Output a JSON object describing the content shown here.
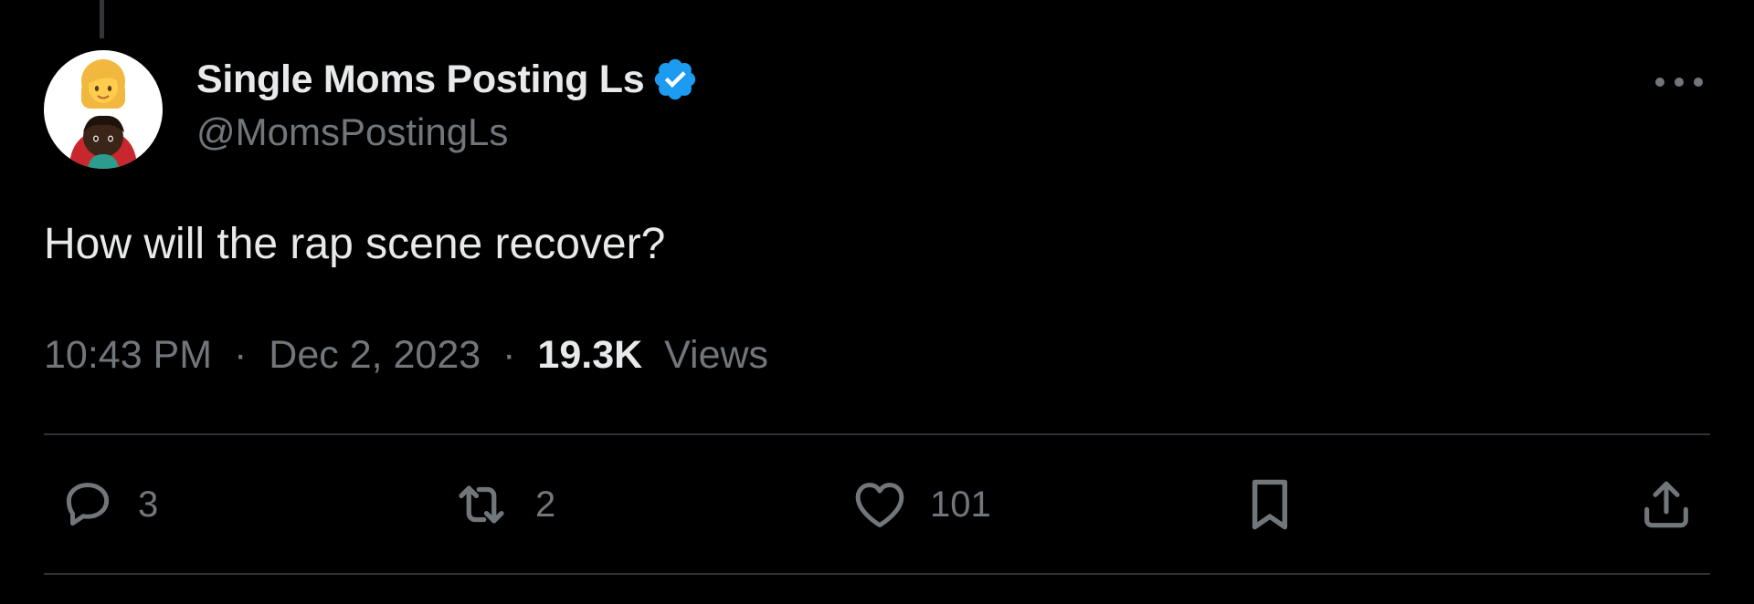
{
  "author": {
    "display_name": "Single Moms Posting Ls",
    "handle": "@MomsPostingLs",
    "verified": true,
    "avatar_icon": "woman-and-child-emoji-avatar"
  },
  "tweet": {
    "text": "How will the rap scene recover?",
    "time": "10:43 PM",
    "separator": "·",
    "date": "Dec 2, 2023",
    "views_count": "19.3K",
    "views_label": "Views"
  },
  "actions": {
    "replies": "3",
    "reposts": "2",
    "likes": "101"
  },
  "colors": {
    "background": "#000000",
    "primary_text": "#e7e9ea",
    "secondary_text": "#71767b",
    "divider": "#2f3336",
    "verified_blue": "#1d9bf0"
  }
}
